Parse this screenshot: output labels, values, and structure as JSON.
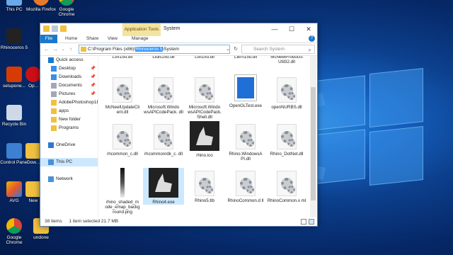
{
  "desktop": {
    "icons": [
      {
        "label": "This PC"
      },
      {
        "label": "Mozilla Firefox"
      },
      {
        "label": "Google Chrome"
      },
      {
        "label": "Rhinoceros 5"
      },
      {
        "label": "setupone..."
      },
      {
        "label": "Op..."
      },
      {
        "label": "Recycle Bin"
      },
      {
        "label": "Control Panel"
      },
      {
        "label": "Dow..."
      },
      {
        "label": "AVG"
      },
      {
        "label": "New"
      },
      {
        "label": "Google Chrome"
      },
      {
        "label": "undone"
      }
    ]
  },
  "window": {
    "title": "System",
    "app_tools": "Application Tools",
    "manage_tab": "Manage",
    "tabs": [
      "File",
      "Home",
      "Share",
      "View"
    ],
    "help": "?",
    "controls": {
      "minimize": "—",
      "maximize": "☐",
      "close": "✕"
    },
    "address": {
      "prefix": "C:\\Program Files (x86)\\",
      "selected": "Rhinoceros 5",
      "suffix": "\\System"
    },
    "search_placeholder": "Search System",
    "status": {
      "count": "38 items",
      "selected": "1 item selected  21.7 MB"
    }
  },
  "nav": [
    {
      "label": "Quick access",
      "level": 0,
      "pin": false,
      "color": "#1979ca"
    },
    {
      "label": "Desktop",
      "level": 1,
      "pin": true,
      "color": "#3a8ee6"
    },
    {
      "label": "Downloads",
      "level": 1,
      "pin": true,
      "color": "#3a8ee6"
    },
    {
      "label": "Documents",
      "level": 1,
      "pin": true,
      "color": "#a0a8b8"
    },
    {
      "label": "Pictures",
      "level": 1,
      "pin": true,
      "color": "#a0a8b8"
    },
    {
      "label": "AdobePhotoshop1E",
      "level": 1,
      "pin": false,
      "color": "#f0c040"
    },
    {
      "label": "apps",
      "level": 1,
      "pin": false,
      "color": "#f0c040"
    },
    {
      "label": "New folder",
      "level": 1,
      "pin": false,
      "color": "#f0c040"
    },
    {
      "label": "Programs",
      "level": 1,
      "pin": false,
      "color": "#f0c040"
    },
    {
      "label": "",
      "level": 1,
      "pin": false,
      "color": "transparent"
    },
    {
      "label": "OneDrive",
      "level": 0,
      "pin": false,
      "color": "#2b78d4"
    },
    {
      "label": "",
      "level": 1,
      "pin": false,
      "color": "transparent"
    },
    {
      "label": "This PC",
      "level": 0,
      "pin": false,
      "color": "#4a90d9"
    },
    {
      "label": "",
      "level": 1,
      "pin": false,
      "color": "transparent"
    },
    {
      "label": "Network",
      "level": 0,
      "pin": false,
      "color": "#4a90d9"
    }
  ],
  "files": [
    {
      "name": "Ltfif15u.dll",
      "kind": "partial"
    },
    {
      "name": "Ltdis15u.dll",
      "kind": "partial"
    },
    {
      "name": "Ltfil15u.dll",
      "kind": "partial"
    },
    {
      "name": "Ltkrn15u.dll",
      "kind": "partial"
    },
    {
      "name": "McNeelProducts Util32.dll",
      "kind": "partial"
    },
    {
      "name": "McNeelUpdateCli ent.dll",
      "kind": "dll"
    },
    {
      "name": "Microsoft.Windo wsAPICodePack. dll",
      "kind": "dll"
    },
    {
      "name": "Microsoft.Windo wsAPICodePack. Shell.dll",
      "kind": "dll"
    },
    {
      "name": "OpenGLTest.exe",
      "kind": "exe"
    },
    {
      "name": "openNURBS.dll",
      "kind": "dll"
    },
    {
      "name": "rhcommon_c.dll",
      "kind": "dll"
    },
    {
      "name": "rhcommonrdk_c. dll",
      "kind": "dll"
    },
    {
      "name": "rhino.ico",
      "kind": "rhino"
    },
    {
      "name": "Rhino.WindowsA PI.dll",
      "kind": "dll"
    },
    {
      "name": "Rhino_DotNet.dll",
      "kind": "dll"
    },
    {
      "name": "rhino_shaded_m ode_emap_backg round.png",
      "kind": "png"
    },
    {
      "name": "Rhino4.exe",
      "kind": "rhino"
    },
    {
      "name": "Rhino5.tlb",
      "kind": "dll"
    },
    {
      "name": "RhinoCommon.d ll",
      "kind": "dll"
    },
    {
      "name": "RhinoCommon.x ml",
      "kind": "dll"
    }
  ]
}
